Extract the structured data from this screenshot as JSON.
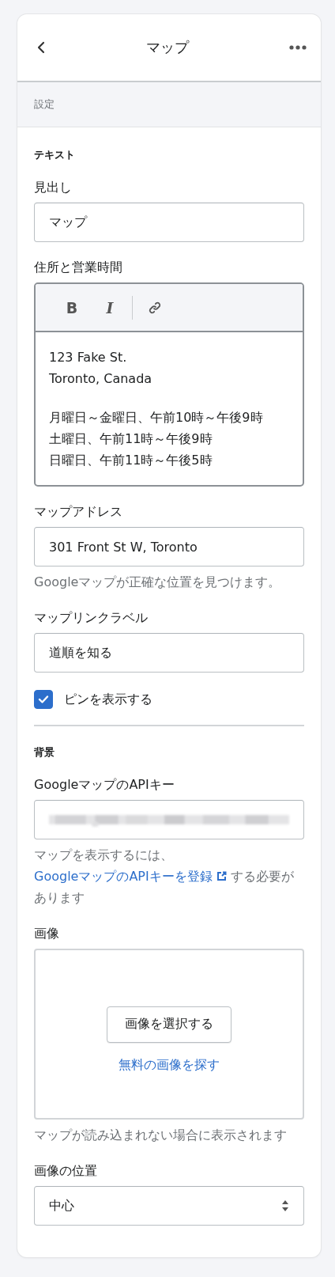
{
  "header": {
    "title": "マップ"
  },
  "section_band": {
    "label": "設定"
  },
  "groups": [
    {
      "heading": "テキスト",
      "fields": [
        {
          "kind": "text",
          "label": "見出し",
          "value": "マップ"
        },
        {
          "kind": "richtext",
          "label": "住所と営業時間",
          "toolbar": [
            {
              "kind": "bold",
              "label": "B"
            },
            {
              "kind": "italic",
              "label": "I"
            },
            {
              "kind": "link"
            }
          ],
          "paragraphs": [
            [
              "123 Fake St.",
              "Toronto, Canada"
            ],
            [
              "月曜日～金曜日、午前10時～午後9時",
              "土曜日、午前11時～午後9時",
              "日曜日、午前11時～午後5時"
            ]
          ]
        },
        {
          "kind": "text",
          "label": "マップアドレス",
          "value": "301 Front St W, Toronto",
          "help": "Googleマップが正確な位置を見つけます。"
        },
        {
          "kind": "text",
          "label": "マップリンクラベル",
          "value": "道順を知る"
        },
        {
          "kind": "checkbox",
          "label": "ピンを表示する",
          "checked": true
        }
      ]
    },
    {
      "heading": "背景",
      "fields": [
        {
          "kind": "secret",
          "label": "GoogleマップのAPIキー",
          "help_before": "マップを表示するには、",
          "help_link": "GoogleマップのAPIキーを登録",
          "help_after": "する必要があります"
        },
        {
          "kind": "image",
          "label": "画像",
          "button": "画像を選択する",
          "link": "無料の画像を探す",
          "help": "マップが読み込まれない場合に表示されます"
        },
        {
          "kind": "select",
          "label": "画像の位置",
          "value": "中心"
        }
      ]
    }
  ]
}
